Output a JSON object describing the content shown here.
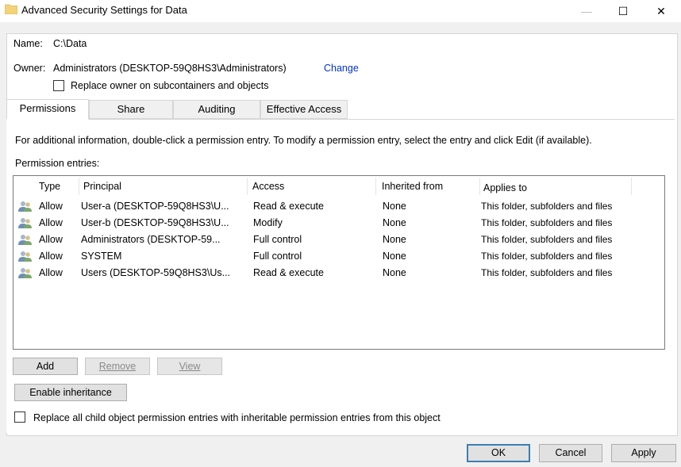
{
  "window": {
    "title": "Advanced Security Settings for Data",
    "min_glyph": "—",
    "max_glyph": "☐",
    "close_glyph": "✕"
  },
  "name": {
    "label": "Name:",
    "value": "C:\\Data"
  },
  "owner": {
    "label": "Owner:",
    "value": "Administrators (DESKTOP-59Q8HS3\\Administrators)",
    "change_link": "Change",
    "replace_label": "Replace owner on  subcontainers and objects"
  },
  "tabs": [
    {
      "label": "Permissions",
      "active": true
    },
    {
      "label": "Share",
      "active": false
    },
    {
      "label": "Auditing",
      "active": false
    },
    {
      "label": "Effective Access",
      "active": false
    }
  ],
  "info_text": "For additional information, double-click a permission entry. To modify a permission entry, select the entry and click Edit (if available).",
  "entries_label": "Permission entries:",
  "columns": {
    "type": "Type",
    "principal": "Principal",
    "access": "Access",
    "inherited": "Inherited from",
    "applies": "Applies to"
  },
  "entries": [
    {
      "type": "Allow",
      "principal": "User-a (DESKTOP-59Q8HS3\\U...",
      "access": "Read & execute",
      "inherited": "None",
      "applies": "This folder, subfolders and files"
    },
    {
      "type": "Allow",
      "principal": "User-b (DESKTOP-59Q8HS3\\U...",
      "access": "Modify",
      "inherited": "None",
      "applies": "This folder, subfolders and files"
    },
    {
      "type": "Allow",
      "principal": "Administrators (DESKTOP-59...",
      "access": "Full control",
      "inherited": "None",
      "applies": "This folder, subfolders and files"
    },
    {
      "type": "Allow",
      "principal": "SYSTEM",
      "access": "Full control",
      "inherited": "None",
      "applies": "This folder, subfolders and files"
    },
    {
      "type": "Allow",
      "principal": "Users (DESKTOP-59Q8HS3\\Us...",
      "access": "Read & execute",
      "inherited": "None",
      "applies": "This folder, subfolders and files"
    }
  ],
  "buttons": {
    "add": "Add",
    "remove": "Remove",
    "view": "View",
    "enable_inheritance": "Enable inheritance",
    "ok": "OK",
    "cancel": "Cancel",
    "apply": "Apply"
  },
  "replace_child_label": "Replace all child object permission entries with inheritable permission entries from this object",
  "colors": {
    "link": "#0033cc",
    "accent_border": "#3c7fb1",
    "folder": "#f3d37a"
  }
}
